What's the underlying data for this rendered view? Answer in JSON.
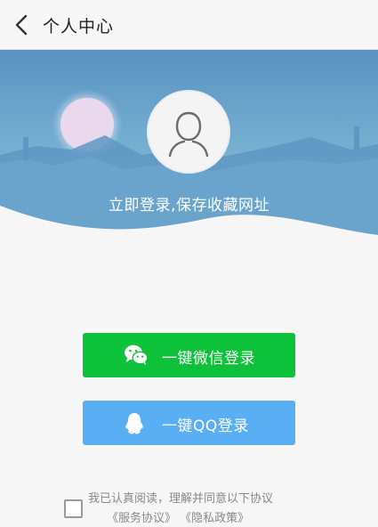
{
  "header": {
    "back_icon": "back-arrow-icon",
    "title": "个人中心"
  },
  "hero": {
    "avatar_icon": "user-silhouette-icon",
    "login_hint": "立即登录,保存收藏网址",
    "sky_color": "#5b94c2",
    "moon_color": "#e8d6ee"
  },
  "buttons": {
    "wechat_label": "一键微信登录",
    "wechat_color": "#0dc23a",
    "wechat_icon": "wechat-icon",
    "qq_label": "一键QQ登录",
    "qq_color": "#5aaef4",
    "qq_icon": "qq-penguin-icon"
  },
  "agreement": {
    "text": "我已认真阅读，理解并同意以下协议",
    "service_link": "《服务协议》",
    "privacy_link": "《隐私政策》",
    "checked": false
  }
}
